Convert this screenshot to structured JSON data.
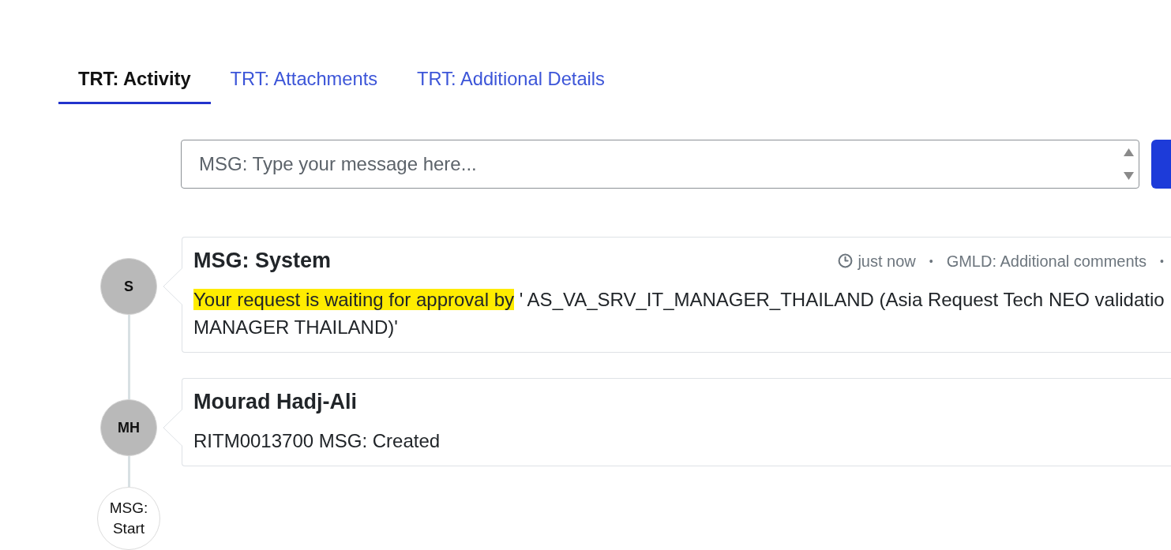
{
  "tabs": [
    {
      "label": "TRT: Activity",
      "selected": true
    },
    {
      "label": "TRT: Attachments",
      "selected": false
    },
    {
      "label": "TRT: Additional Details",
      "selected": false
    }
  ],
  "composer": {
    "placeholder": "MSG: Type your message here..."
  },
  "timeline": {
    "entries": [
      {
        "initials": "S",
        "author": "MSG: System",
        "meta": [
          {
            "kind": "time",
            "text": "just now"
          },
          {
            "kind": "separator",
            "text": "•"
          },
          {
            "kind": "label",
            "text": "GMLD: Additional comments"
          },
          {
            "kind": "separator",
            "text": "•"
          }
        ],
        "highlight": "Your request is waiting for approval by",
        "lines": [
          "' AS_VA_SRV_IT_MANAGER_THAILAND (Asia Request Tech NEO validatio",
          "MANAGER THAILAND)'"
        ]
      },
      {
        "initials": "MH",
        "author": "Mourad Hadj-Ali",
        "lines": [
          "RITM0013700 MSG: Created"
        ]
      }
    ],
    "start": {
      "label": "MSG: Start"
    }
  }
}
